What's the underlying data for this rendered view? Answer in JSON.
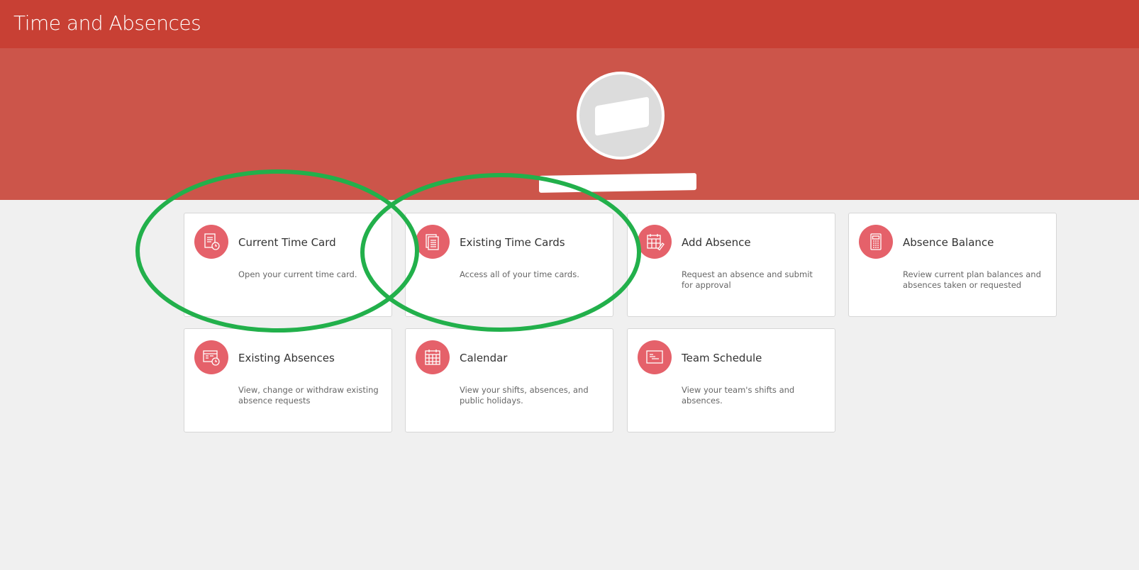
{
  "header": {
    "title": "Time and Absences"
  },
  "cards": [
    {
      "title": "Current Time Card",
      "description": "Open your current time card.",
      "icon": "timecard-clock-icon"
    },
    {
      "title": "Existing Time Cards",
      "description": "Access all of your time cards.",
      "icon": "documents-stack-icon"
    },
    {
      "title": "Add Absence",
      "description": "Request an absence and submit for approval",
      "icon": "calendar-edit-icon"
    },
    {
      "title": "Absence Balance",
      "description": "Review current plan balances and absences taken or requested",
      "icon": "calculator-icon"
    },
    {
      "title": "Existing Absences",
      "description": "View, change or withdraw existing absence requests",
      "icon": "calendar-clock-icon"
    },
    {
      "title": "Calendar",
      "description": "View your shifts, absences, and public holidays.",
      "icon": "calendar-icon"
    },
    {
      "title": "Team Schedule",
      "description": "View your team's shifts and absences.",
      "icon": "schedule-board-icon"
    }
  ],
  "colors": {
    "header": "#c84034",
    "banner": "#cc554a",
    "icon_bg": "#e5616a",
    "annotation": "#22b04b"
  }
}
